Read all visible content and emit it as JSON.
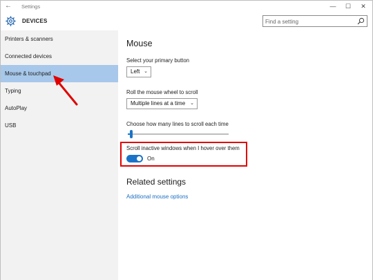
{
  "window": {
    "app_title": "Settings",
    "back_icon": "back-arrow-icon",
    "controls": [
      "minimize-icon",
      "maximize-icon",
      "close-icon"
    ]
  },
  "header": {
    "icon": "gear-icon",
    "title": "DEVICES"
  },
  "search": {
    "placeholder": "Find a setting",
    "icon": "search-icon"
  },
  "sidebar": {
    "items": [
      {
        "label": "Printers & scanners",
        "selected": false
      },
      {
        "label": "Connected devices",
        "selected": false
      },
      {
        "label": "Mouse & touchpad",
        "selected": true
      },
      {
        "label": "Typing",
        "selected": false
      },
      {
        "label": "AutoPlay",
        "selected": false
      },
      {
        "label": "USB",
        "selected": false
      }
    ]
  },
  "main": {
    "title": "Mouse",
    "primary_button": {
      "label": "Select your primary button",
      "value": "Left"
    },
    "scroll_wheel": {
      "label": "Roll the mouse wheel to scroll",
      "value": "Multiple lines at a time"
    },
    "lines_to_scroll": {
      "label": "Choose how many lines to scroll each time",
      "value_fraction": 0.02
    },
    "inactive_scroll": {
      "label": "Scroll inactive windows when I hover over them",
      "state": "On"
    },
    "related": {
      "title": "Related settings",
      "link": "Additional mouse options"
    }
  },
  "colors": {
    "accent": "#1a73c7",
    "selected_bg": "#a7c8ea",
    "annotation": "#e00000",
    "sidebar_bg": "#f2f2f2"
  }
}
